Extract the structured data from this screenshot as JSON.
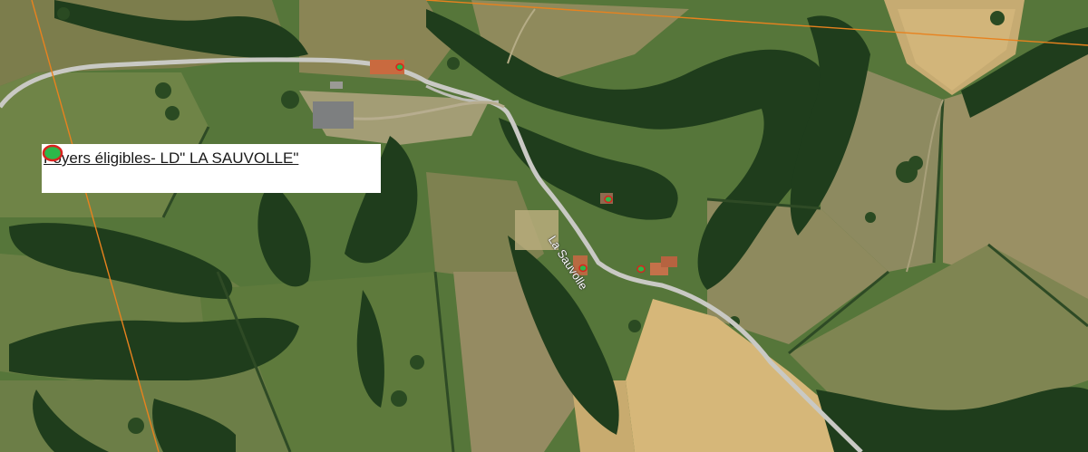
{
  "legend": {
    "label": "Foyers éligibles- LD\" LA SAUVOLLE\"",
    "symbol": {
      "fill": "#2db84a",
      "stroke": "#d9231f"
    }
  },
  "road_label": "La Sauvolle",
  "colors": {
    "boundary_line": "#e8821e",
    "road": "#c9c9c4",
    "forest": "#1f3d1c",
    "pasture": "#5f7d3f",
    "dry_field": "#b89d64",
    "stubble_field": "#d3b477",
    "eligible_marker_fill": "#2db84a",
    "eligible_marker_stroke": "#d9231f"
  },
  "eligible_markers_count": 4
}
